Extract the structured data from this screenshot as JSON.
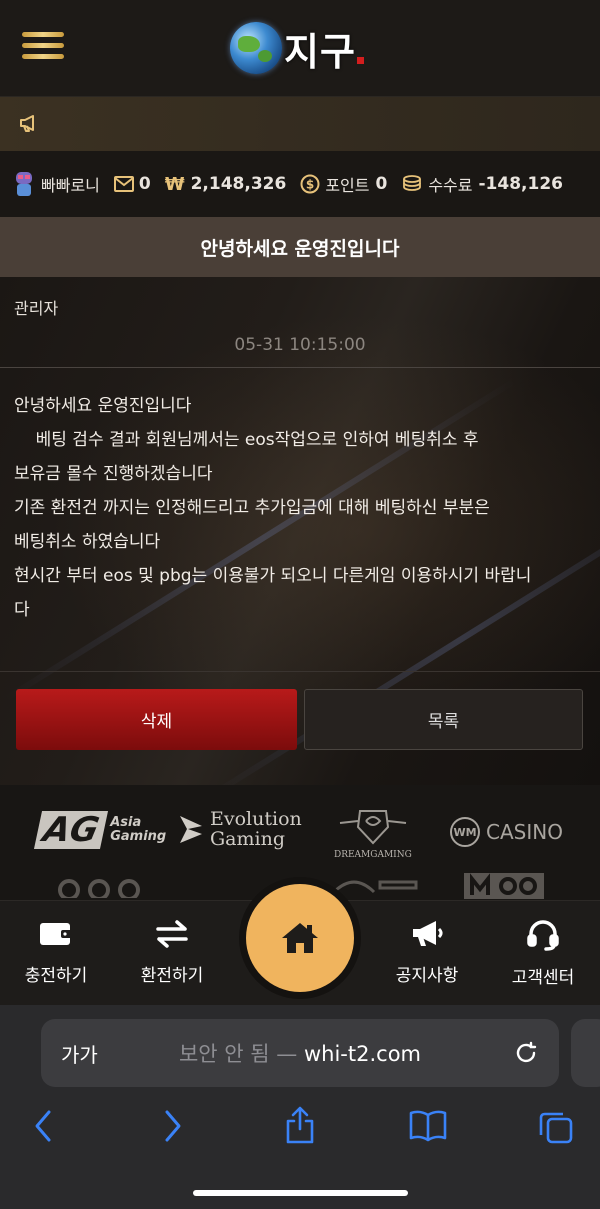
{
  "header": {
    "logo_text": "지구",
    "menu_icon": "hamburger-menu-icon"
  },
  "notice_bar": {
    "icon": "megaphone-icon"
  },
  "userbar": {
    "username": "빠빠로니",
    "messages": "0",
    "balance_symbol": "₩",
    "balance": "2,148,326",
    "points_label": "포인트",
    "points": "0",
    "fee_label": "수수료",
    "fee": "-148,126"
  },
  "post": {
    "title": "안녕하세요 운영진입니다",
    "author": "관리자",
    "date": "05-31 10:15:00",
    "body": "안녕하세요 운영진입니다\n    베팅 검수 결과 회원님께서는 eos작업으로 인하여 베팅취소 후\n보유금 몰수 진행하겠습니다\n기존 환전건 까지는 인정해드리고 추가입금에 대해 베팅하신 부분은\n베팅취소 하였습니다\n현시간 부터 eos 및 pbg는 이용불가 되오니 다른게임 이용하시기 바랍니\n다",
    "delete_label": "삭제",
    "list_label": "목록"
  },
  "providers": {
    "ag": "AG",
    "ag_sub1": "Asia",
    "ag_sub2": "Gaming",
    "evo1": "Evolution",
    "evo2": "Gaming",
    "dream": "DREAMGAMING",
    "wm": "WM",
    "casino": "CASINO"
  },
  "tabbar": {
    "deposit": "충전하기",
    "exchange": "환전하기",
    "notice": "공지사항",
    "support": "고객센터"
  },
  "browser": {
    "aa_label": "가가",
    "url_warning": "보안 안 됨 —",
    "url": "whi-t2.com"
  },
  "colors": {
    "accent": "#f0b45e",
    "delete": "#b81a1a",
    "title_bar": "#4a3f37"
  }
}
